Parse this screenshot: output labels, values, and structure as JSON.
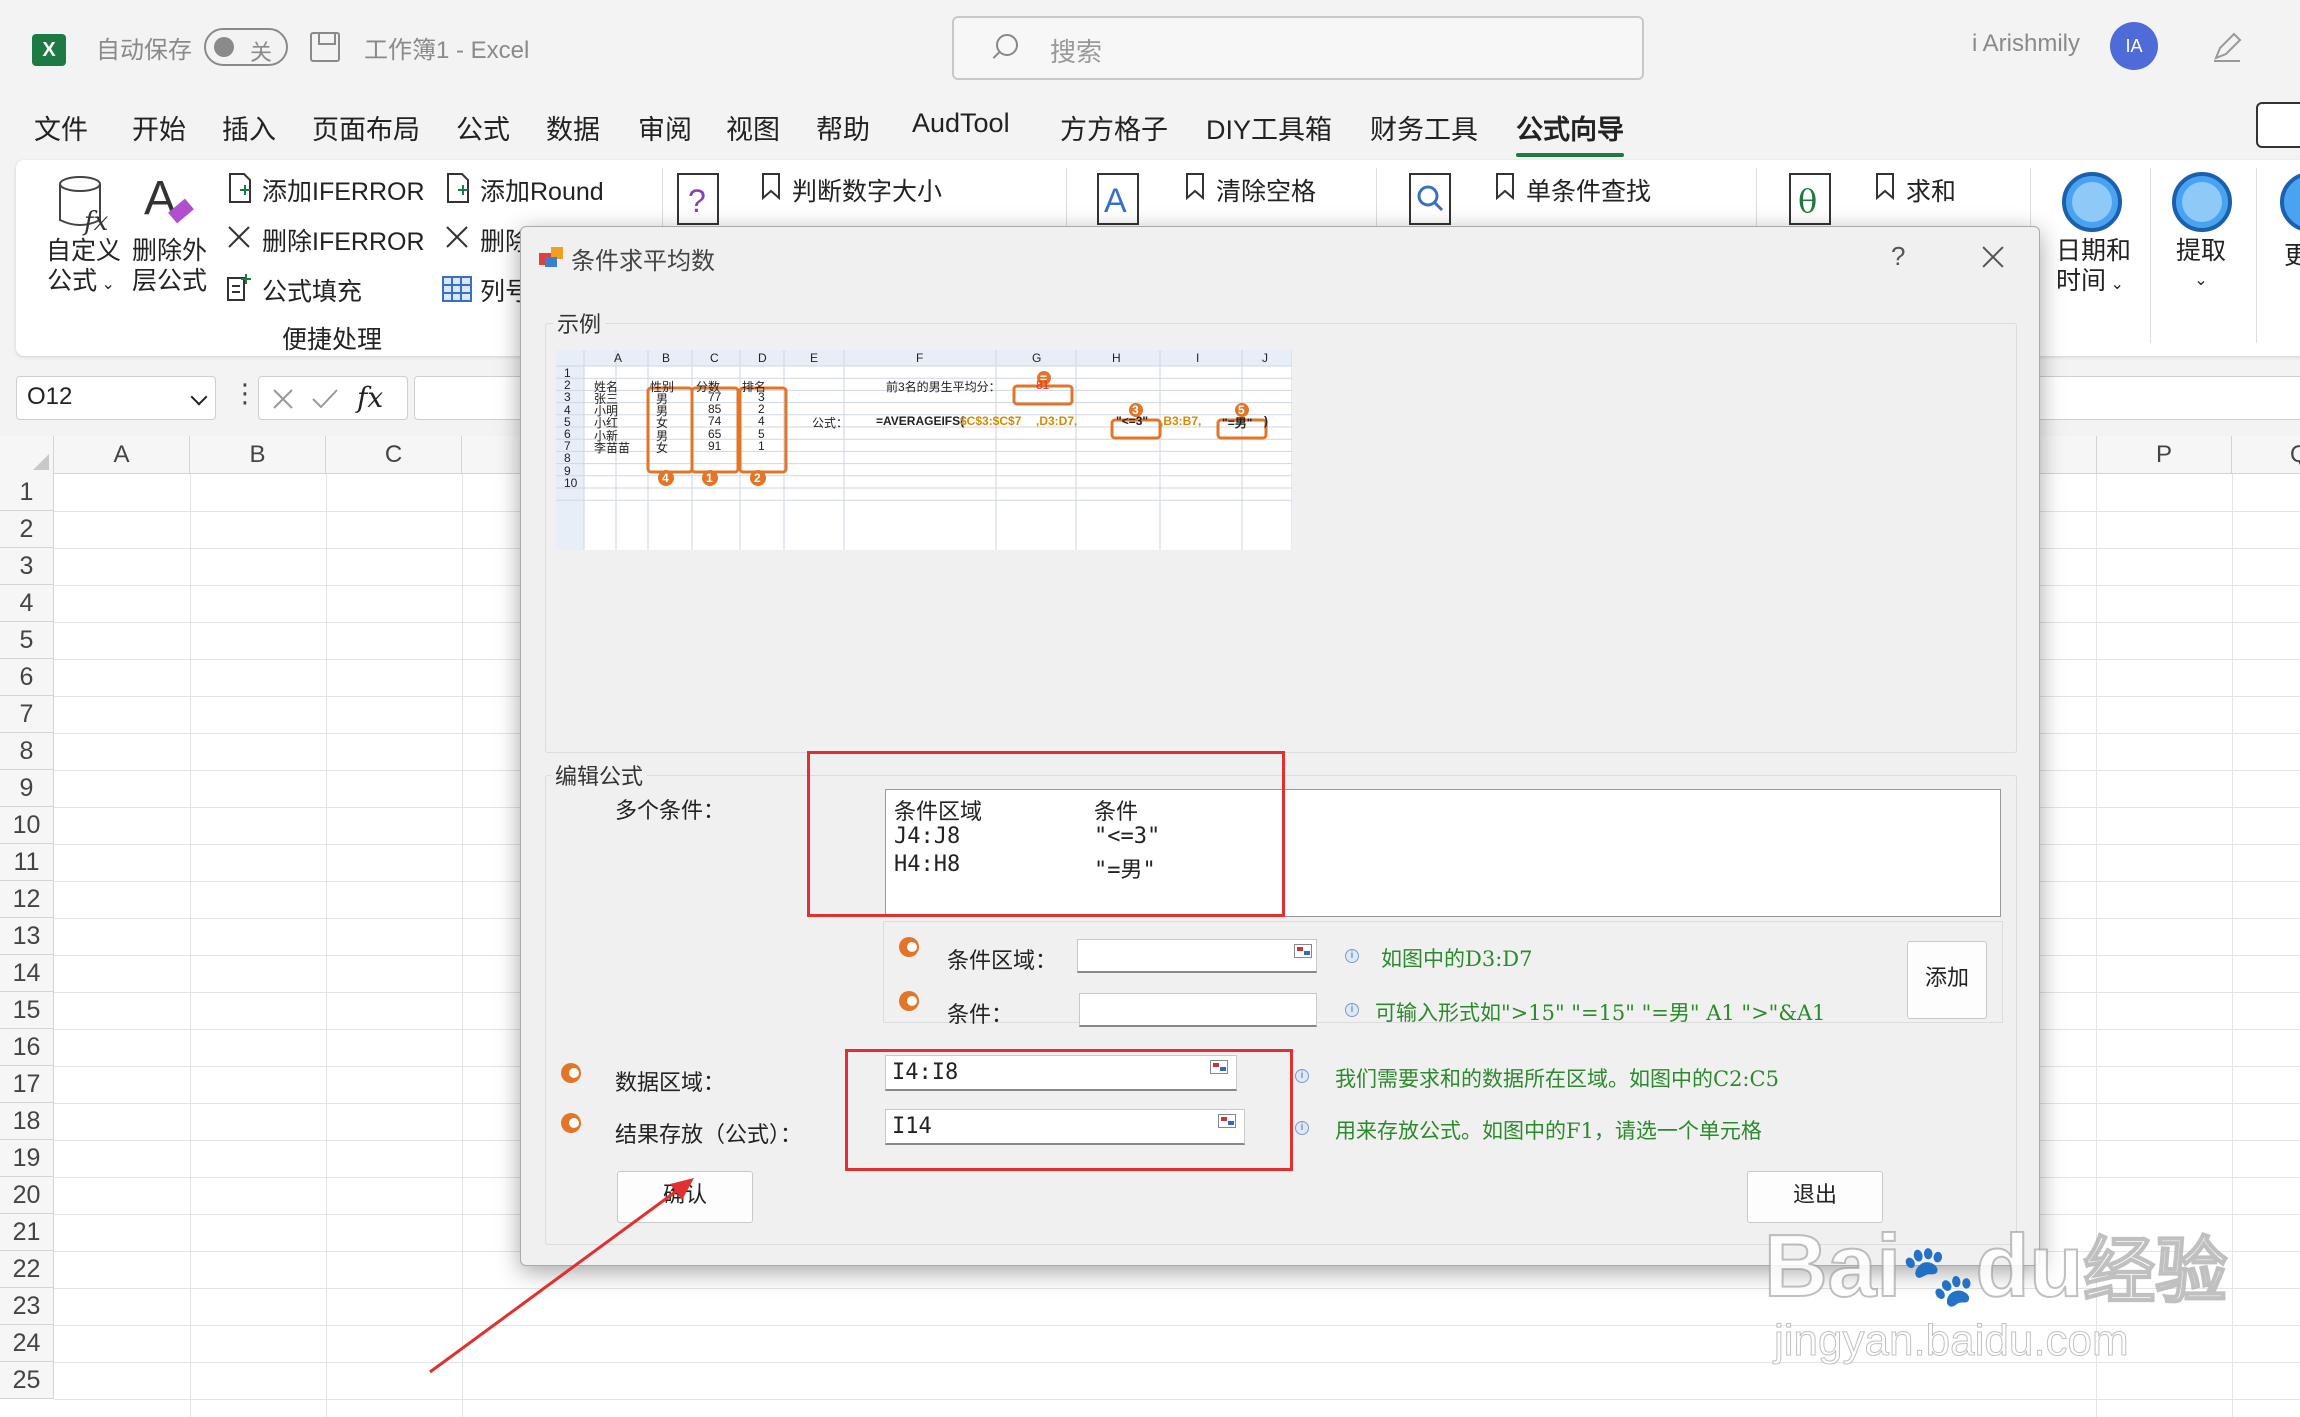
{
  "titlebar": {
    "app_logo": "X",
    "autosave_label": "自动保存",
    "autosave_state": "关",
    "doc_title": "工作簿1  -  Excel",
    "search_placeholder": "搜索",
    "user_name": "i Arishmily",
    "avatar_initials": "IA"
  },
  "menu": [
    "文件",
    "开始",
    "插入",
    "页面布局",
    "公式",
    "数据",
    "审阅",
    "视图",
    "帮助",
    "AudTool",
    "方方格子",
    "DIY工具箱",
    "财务工具",
    "公式向导"
  ],
  "ribbon": {
    "custom_formula": [
      "自定义",
      "公式"
    ],
    "remove_outer": [
      "删除外",
      "层公式"
    ],
    "add_iferror": "添加IFERROR",
    "del_iferror": "删除IFERROR",
    "formula_fill": "公式填充",
    "add_round": "添加Round",
    "del_partial": "删除",
    "col_partial": "列号",
    "group_label": "便捷处理",
    "judge_num": "判断数字大小",
    "clear_space": "清除空格",
    "single_lookup": "单条件查找",
    "sum": "求和",
    "datetime": [
      "日期和",
      "时间"
    ],
    "extract": "提取",
    "more_partial": "更"
  },
  "formula_bar": {
    "namebox": "O12",
    "fx": "fx"
  },
  "grid": {
    "columns": [
      "A",
      "B",
      "C",
      "P",
      "Q"
    ],
    "rows": [
      "1",
      "2",
      "3",
      "4",
      "5",
      "6",
      "7",
      "8",
      "9",
      "10",
      "11",
      "12",
      "13",
      "14",
      "15",
      "16",
      "17",
      "18",
      "19",
      "20",
      "21",
      "22",
      "23",
      "24",
      "25"
    ]
  },
  "dialog": {
    "title": "条件求平均数",
    "help": "?",
    "example_legend": "示例",
    "mini_sheet": {
      "cols": [
        "A",
        "B",
        "C",
        "D",
        "E",
        "F",
        "G",
        "H",
        "I",
        "J"
      ],
      "rows": [
        "1",
        "2",
        "3",
        "4",
        "5",
        "6",
        "7",
        "8",
        "9",
        "10"
      ],
      "headers": [
        "姓名",
        "性别",
        "分数",
        "排名"
      ],
      "names": [
        "张三",
        "小明",
        "小红",
        "小新",
        "李苗苗"
      ],
      "genders": [
        "男",
        "男",
        "女",
        "男",
        "女"
      ],
      "scores": [
        "77",
        "85",
        "74",
        "65",
        "91"
      ],
      "ranks": [
        "3",
        "2",
        "4",
        "5",
        "1"
      ],
      "label_top3": "前3名的男生平均分：",
      "result": "81",
      "formula_label": "公式：",
      "formula_prefix": "=AVERAGEIFS(",
      "formula_sum": "$C$3:$C$7",
      "formula_mid": ",D3:D7,",
      "formula_c1": "\"<=3\"",
      "formula_r2": ",B3:B7,",
      "formula_c2": "\"=男\"",
      "formula_end": ")",
      "marker_1": "1",
      "marker_2": "2",
      "marker_3": "3",
      "marker_4": "4",
      "marker_5": "5",
      "marker_eq": "="
    },
    "edit_legend": "编辑公式",
    "multi_cond_label": "多个条件：",
    "cond_list": {
      "headers": [
        "条件区域",
        "条件"
      ],
      "rows": [
        {
          "range": "J4:J8",
          "cond": "\"<=3\""
        },
        {
          "range": "H4:H8",
          "cond": "\"=男\""
        }
      ]
    },
    "cond_range_label": "条件区域：",
    "cond_range_value": "",
    "cond_range_hint": "如图中的D3:D7",
    "cond_label": "条件：",
    "cond_value": "",
    "cond_hint": "可输入形式如\">15\"  \"=15\"  \"=男\"  A1  \">\"&A1",
    "add_button": "添加",
    "data_range_label": "数据区域：",
    "data_range_value": "I4:I8",
    "data_range_hint": "我们需要求和的数据所在区域。如图中的C2:C5",
    "result_label": "结果存放（公式）：",
    "result_value": "I14",
    "result_hint": "用来存放公式。如图中的F1，请选一个单元格",
    "confirm_button": "确认",
    "exit_button": "退出"
  },
  "watermark": {
    "brand": "Bai",
    "brand2": "du",
    "brand3": "经验",
    "url": "jingyan.baidu.com"
  },
  "colors": {
    "excel_green": "#1d7a43",
    "annotation_red": "#e03030",
    "hint_green": "#2b8a2b",
    "marker_orange": "#e27527"
  }
}
